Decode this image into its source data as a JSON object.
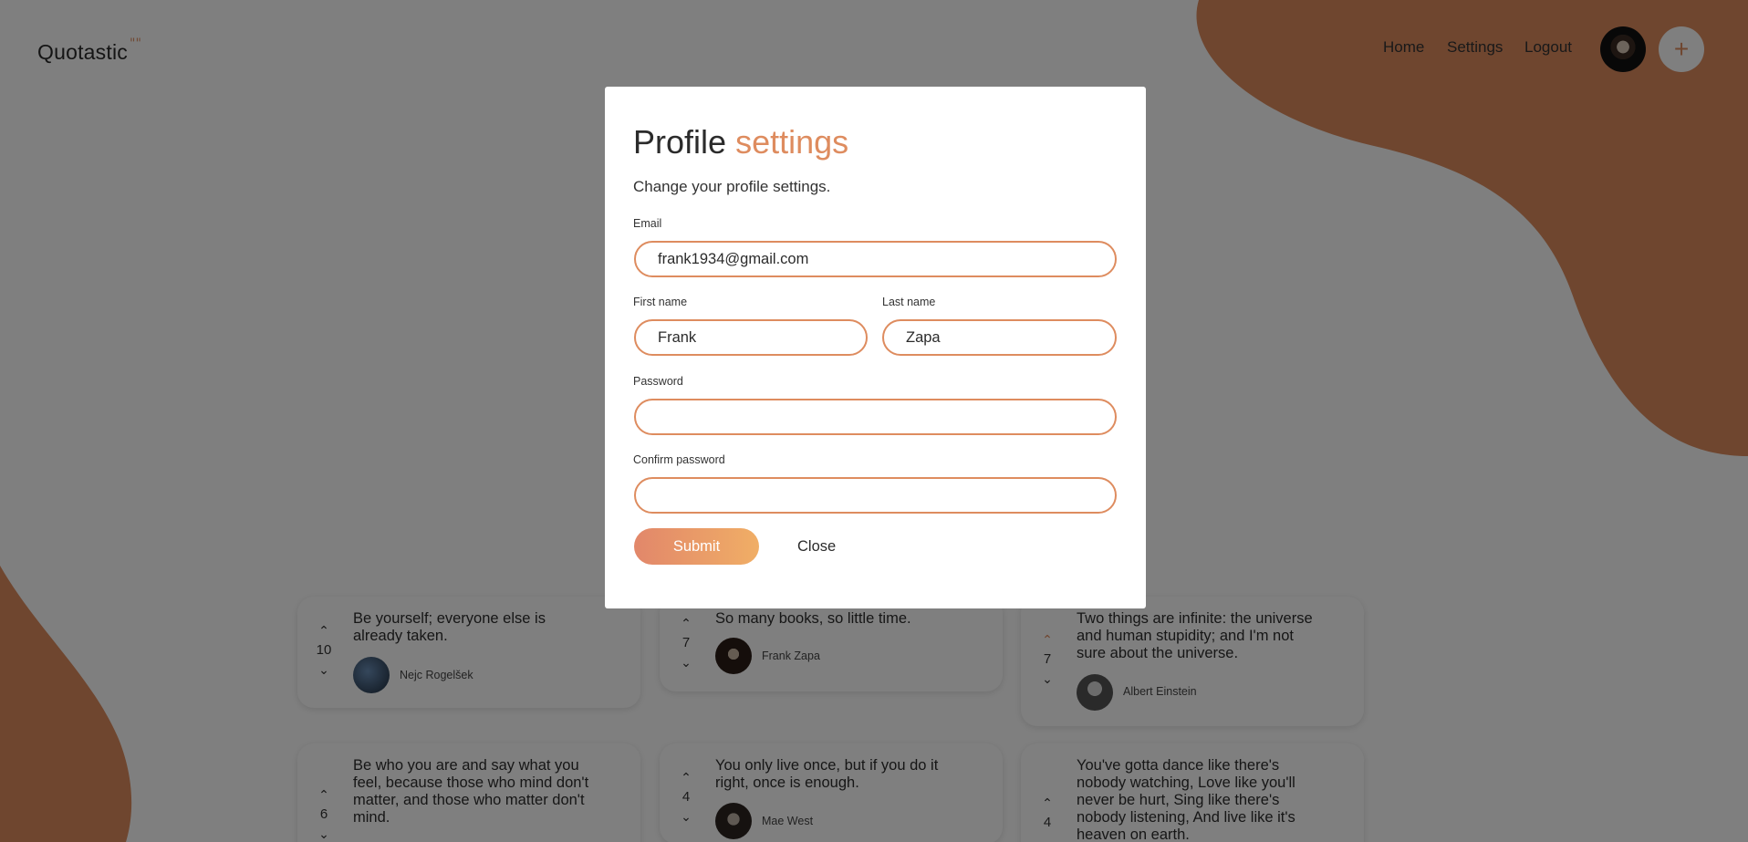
{
  "app": {
    "logo": "Quotastic",
    "logo_mark": "\"\""
  },
  "nav": {
    "home": "Home",
    "settings": "Settings",
    "logout": "Logout",
    "add": "+"
  },
  "colors": {
    "accent": "#DE8C5F",
    "blob": "#DE8C5F",
    "overlay": "rgba(0,0,0,0.5)"
  },
  "quotes": [
    {
      "text": "Be yourself; everyone else is already taken.",
      "votes": "10",
      "author": "Nejc Rogelšek",
      "upvoted": false
    },
    {
      "text": "So many books, so little time.",
      "votes": "7",
      "author": "Frank Zapa",
      "upvoted": false
    },
    {
      "text": "Two things are infinite: the universe and human stupidity; and I'm not sure about the universe.",
      "votes": "7",
      "author": "Albert Einstein",
      "upvoted": true
    },
    {
      "text": "Be who you are and say what you feel, because those who mind don't matter, and those who matter don't mind.",
      "votes": "6",
      "author": "",
      "upvoted": false
    },
    {
      "text": "You only live once, but if you do it right, once is enough.",
      "votes": "4",
      "author": "Mae West",
      "upvoted": false
    },
    {
      "text": "You've gotta dance like there's nobody watching, Love like you'll never be hurt, Sing like there's nobody listening, And live like it's heaven on earth.",
      "votes": "4",
      "author": "",
      "upvoted": false
    }
  ],
  "modal": {
    "title_main": "Profile",
    "title_accent": "settings",
    "subtitle": "Change your profile settings.",
    "email_label": "Email",
    "email_value": "frank1934@gmail.com",
    "first_name_label": "First name",
    "first_name_value": "Frank",
    "last_name_label": "Last name",
    "last_name_value": "Zapa",
    "password_label": "Password",
    "password_value": "",
    "confirm_label": "Confirm password",
    "confirm_value": "",
    "submit": "Submit",
    "close": "Close"
  }
}
